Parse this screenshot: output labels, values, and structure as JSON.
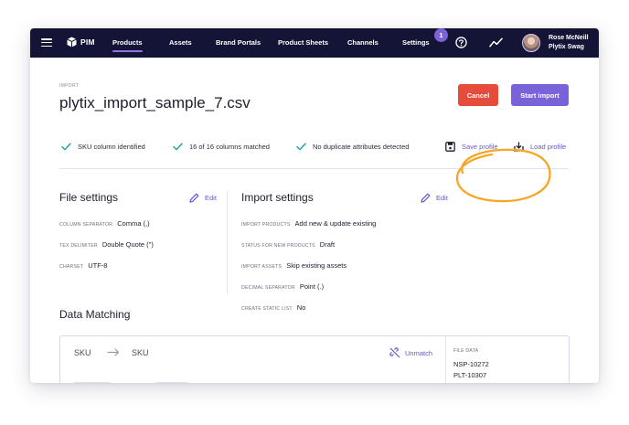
{
  "nav": {
    "logo_text": "PIM",
    "items": [
      {
        "label": "Products",
        "active": true
      },
      {
        "label": "Assets"
      },
      {
        "label": "Brand Portals"
      },
      {
        "label": "Product Sheets"
      },
      {
        "label": "Channels"
      },
      {
        "label": "Settings"
      }
    ],
    "notification_count": "1",
    "user": {
      "name": "Rose McNeill",
      "company": "Plytix Swag"
    }
  },
  "header": {
    "breadcrumb": "IMPORT",
    "title": "plytix_import_sample_7.csv",
    "cancel_label": "Cancel",
    "start_label": "Start import"
  },
  "checks": [
    "SKU column identified",
    "16 of 16 columns matched",
    "No duplicate attributes detected"
  ],
  "profile": {
    "save_label": "Save profile",
    "load_label": "Load profile"
  },
  "file_settings": {
    "title": "File settings",
    "edit_label": "Edit",
    "rows": [
      {
        "key": "COLUMN SEPARATOR",
        "value": "Comma (,)"
      },
      {
        "key": "TEX DELIMITER",
        "value": "Double Quote (\")"
      },
      {
        "key": "CHARSET",
        "value": "UTF-8"
      }
    ]
  },
  "import_settings": {
    "title": "Import settings",
    "edit_label": "Edit",
    "rows": [
      {
        "key": "IMPORT PRODUCTS",
        "value": "Add new & update existing"
      },
      {
        "key": "STATUS FOR NEW PRODUCTS",
        "value": "Draft"
      },
      {
        "key": "IMPORT ASSETS",
        "value": "Skip existing assets"
      },
      {
        "key": "DECIMAL SEPARATOR",
        "value": "Point (.)"
      },
      {
        "key": "CREATE STATIC LIST",
        "value": "No"
      }
    ]
  },
  "data_matching": {
    "title": "Data Matching",
    "source_column": "SKU",
    "target_attribute": "SKU",
    "unmatch_label": "Unmatch",
    "file_data_label": "FILE DATA",
    "file_data_values": [
      "NSP-10272",
      "PLT-10307"
    ]
  },
  "colors": {
    "nav_bg": "#141437",
    "accent": "#7a63d9",
    "danger": "#e64c3c",
    "check": "#2aa89a",
    "annotation": "#f5a623"
  },
  "icons": [
    "hamburger-icon",
    "cube-logo-icon",
    "help-icon",
    "activity-icon",
    "check-icon",
    "save-icon",
    "load-icon",
    "pencil-icon",
    "arrow-right-icon",
    "unlink-icon"
  ]
}
